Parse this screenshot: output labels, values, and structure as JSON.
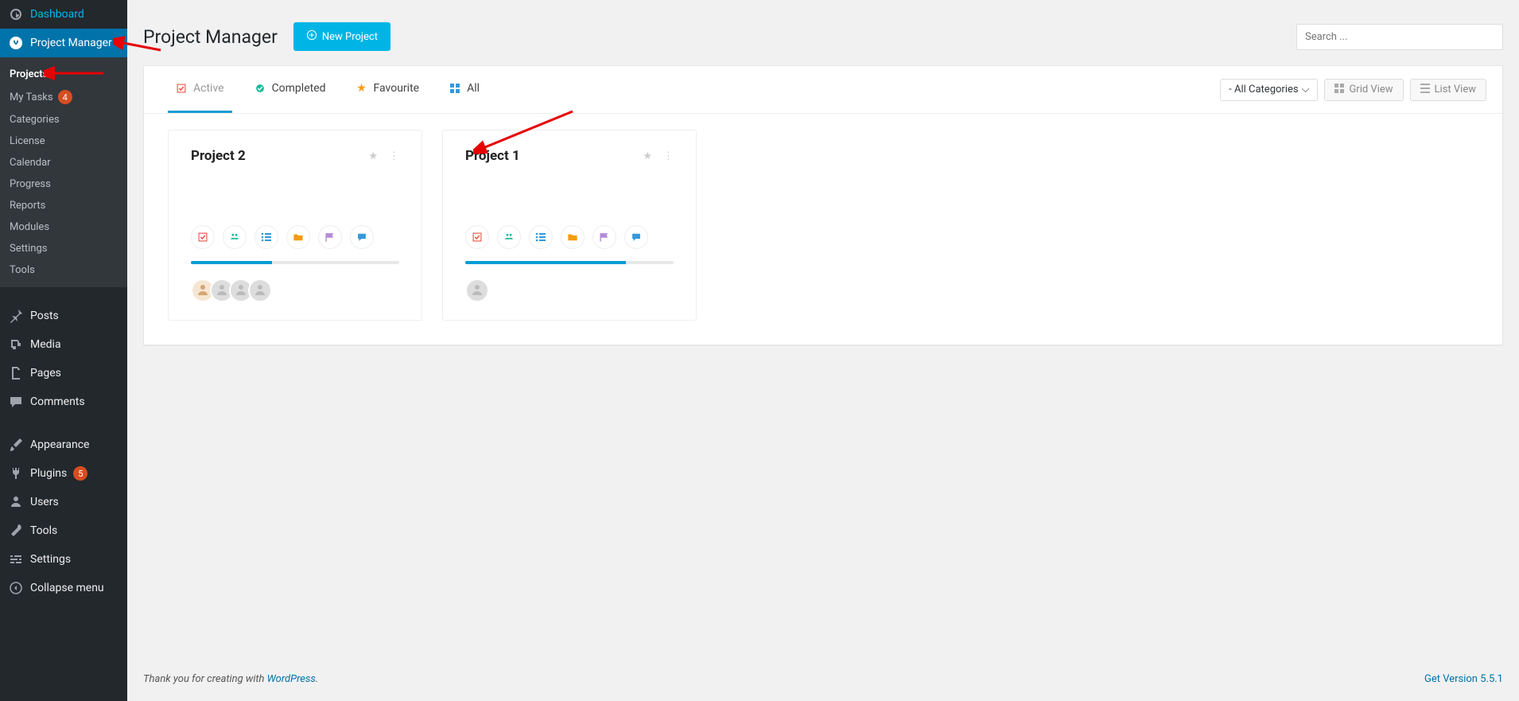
{
  "sidebar": {
    "main_items": [
      {
        "label": "Dashboard",
        "icon": "dashboard"
      },
      {
        "label": "Project Manager",
        "icon": "pm",
        "active": true
      },
      {
        "label": "Posts",
        "icon": "pin"
      },
      {
        "label": "Media",
        "icon": "media"
      },
      {
        "label": "Pages",
        "icon": "page"
      },
      {
        "label": "Comments",
        "icon": "comment"
      },
      {
        "label": "Appearance",
        "icon": "brush"
      },
      {
        "label": "Plugins",
        "icon": "plug",
        "badge": "5"
      },
      {
        "label": "Users",
        "icon": "user"
      },
      {
        "label": "Tools",
        "icon": "wrench"
      },
      {
        "label": "Settings",
        "icon": "sliders"
      },
      {
        "label": "Collapse menu",
        "icon": "collapse"
      }
    ],
    "sub_items": [
      {
        "label": "Projects",
        "current": true
      },
      {
        "label": "My Tasks",
        "badge": "4"
      },
      {
        "label": "Categories"
      },
      {
        "label": "License"
      },
      {
        "label": "Calendar"
      },
      {
        "label": "Progress"
      },
      {
        "label": "Reports"
      },
      {
        "label": "Modules"
      },
      {
        "label": "Settings"
      },
      {
        "label": "Tools"
      }
    ]
  },
  "header": {
    "title": "Project Manager",
    "new_btn": "New Project",
    "search_placeholder": "Search ..."
  },
  "tabs": {
    "active": "Active",
    "completed": "Completed",
    "favourite": "Favourite",
    "all": "All",
    "categories_dd": "- All Categories",
    "grid": "Grid View",
    "list": "List View"
  },
  "projects": [
    {
      "title": "Project 2",
      "progress": 39,
      "avatars": 4
    },
    {
      "title": "Project 1",
      "progress": 77,
      "avatars": 1
    }
  ],
  "footer": {
    "thanks_pre": "Thank you for creating with ",
    "thanks_link": "WordPress",
    "version": "Get Version 5.5.1"
  }
}
